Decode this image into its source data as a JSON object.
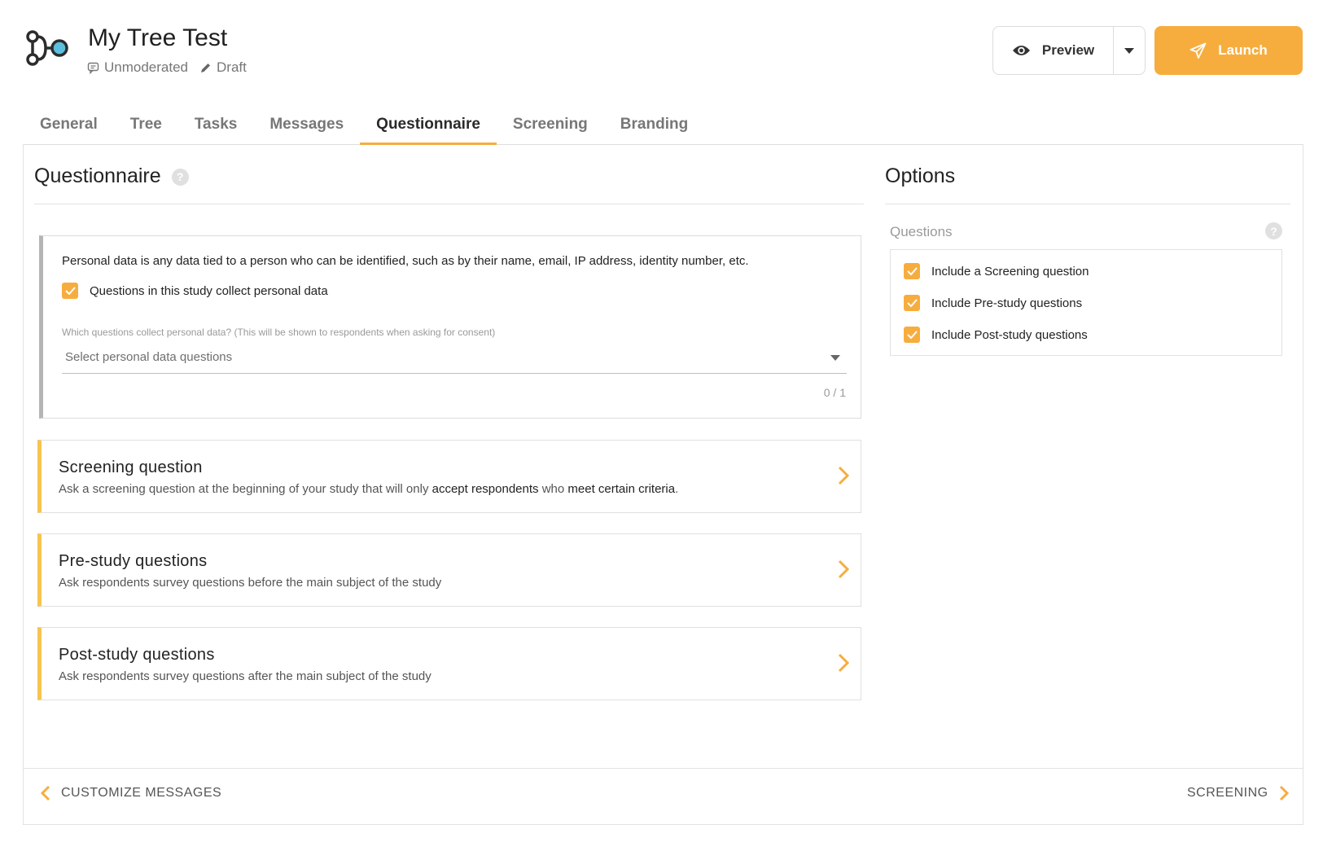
{
  "header": {
    "title": "My Tree Test",
    "mode": "Unmoderated",
    "status": "Draft",
    "preview_label": "Preview",
    "launch_label": "Launch"
  },
  "tabs": [
    "General",
    "Tree",
    "Tasks",
    "Messages",
    "Questionnaire",
    "Screening",
    "Branding"
  ],
  "active_tab": "Questionnaire",
  "questionnaire": {
    "title": "Questionnaire",
    "consent_text": "Personal data is any data tied to a person who can be identified, such as by their name, email, IP address, identity number, etc.",
    "consent_checkbox_label": "Questions in this study collect personal data",
    "consent_checked": true,
    "field_label": "Which questions collect personal data? (This will be shown to respondents when asking for consent)",
    "select_placeholder": "Select personal data questions",
    "counter": "0 / 1",
    "sections": [
      {
        "title": "Screening question",
        "desc_1": "Ask a screening question at the beginning of your study that will only ",
        "desc_b1": "accept respondents",
        "desc_2": " who ",
        "desc_b2": "meet certain criteria",
        "desc_3": "."
      },
      {
        "title": "Pre-study questions",
        "desc_1": "Ask respondents survey questions before the main subject of the study"
      },
      {
        "title": "Post-study questions",
        "desc_1": "Ask respondents survey questions after the main subject of the study"
      }
    ]
  },
  "options": {
    "title": "Options",
    "group_label": "Questions",
    "items": [
      {
        "label": "Include a Screening question",
        "checked": true
      },
      {
        "label": "Include Pre-study questions",
        "checked": true
      },
      {
        "label": "Include Post-study questions",
        "checked": true
      }
    ]
  },
  "footer": {
    "prev_label": "CUSTOMIZE MESSAGES",
    "next_label": "SCREENING"
  },
  "colors": {
    "accent": "#f7ad3e",
    "card_accent": "#f7c44f",
    "logo_dot": "#5bc0de"
  },
  "icons": [
    "tree-logo-icon",
    "chat-icon",
    "pencil-icon",
    "eye-icon",
    "caret-down-icon",
    "paper-plane-icon",
    "help-icon",
    "check-icon",
    "chevron-right-icon",
    "chevron-left-icon"
  ]
}
